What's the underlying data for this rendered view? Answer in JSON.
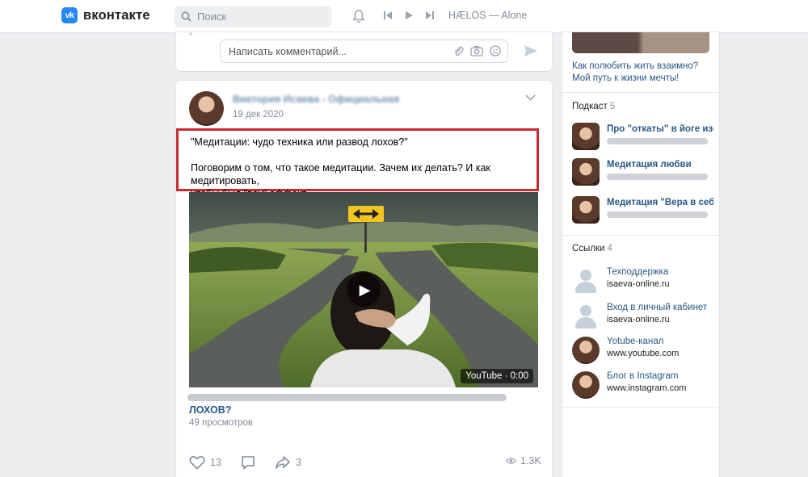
{
  "header": {
    "logo_mark": "vk",
    "logo_text": "вконтакте",
    "search_placeholder": "Поиск",
    "track": "HÆLOS — Alone"
  },
  "comment": {
    "placeholder": "Написать комментарий..."
  },
  "post": {
    "author": "Виктория Исаева - Официальная страница",
    "date": "19 дек 2020",
    "text_line1": "\"Медитации: чудо техника или развод лохов?\"",
    "text_line2": "Поговорим о том, что такое медитации. Зачем их делать? И как медитировать,",
    "text_line3": "чтобы был \"вау\"-эффект.",
    "video_badge": "YouTube · 0:00",
    "video_title_visible": "ЛОХОВ?",
    "views": "49 просмотров",
    "likes": "13",
    "shares": "3",
    "view_count": "1.3K"
  },
  "sidebar": {
    "top_link_line1": "Как полюбить жить взаимно?",
    "top_link_line2": "Мой путь к жизни мечты!",
    "podcasts_title": "Подкаст",
    "podcasts_count": "5",
    "podcasts": [
      {
        "title": "Про \"откаты\" в йоге изо..."
      },
      {
        "title": "Медитация любви"
      },
      {
        "title": "Медитация \"Вера в себя\""
      }
    ],
    "links_title": "Ссылки",
    "links_count": "4",
    "links": [
      {
        "title": "Техподдержка",
        "url": "isaeva-online.ru"
      },
      {
        "title": "Вход в личный кабинет",
        "url": "isaeva-online.ru"
      },
      {
        "title": "Yotube-канал",
        "url": "www.youtube.com"
      },
      {
        "title": "Блог в Instagram",
        "url": "www.instagram.com"
      }
    ]
  },
  "colors": {
    "brand": "#2787f5",
    "link": "#2a5885",
    "highlight_border": "#c92a32"
  }
}
